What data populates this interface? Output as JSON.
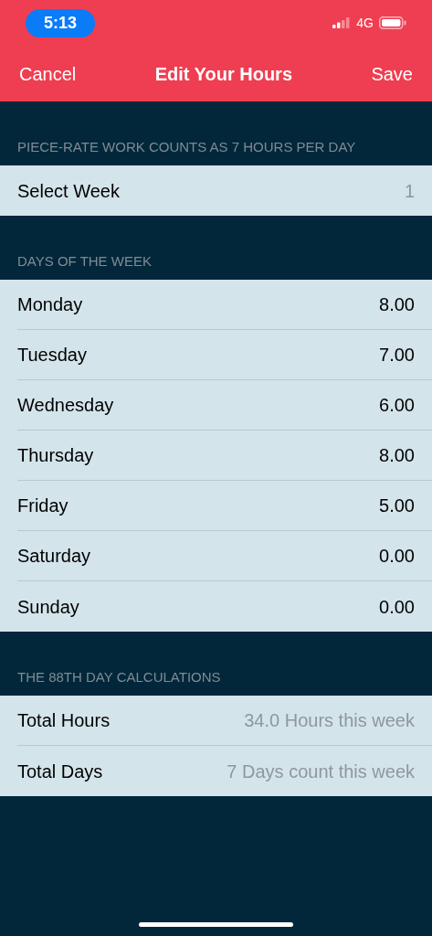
{
  "status_bar": {
    "time": "5:13",
    "network": "4G"
  },
  "nav_bar": {
    "cancel": "Cancel",
    "title": "Edit Your Hours",
    "save": "Save"
  },
  "sections": [
    {
      "header": "PIECE-RATE WORK COUNTS AS 7 HOURS PER DAY",
      "rows": [
        {
          "label": "Select Week",
          "value": "1",
          "kind": "detail"
        }
      ]
    },
    {
      "header": "DAYS OF THE WEEK",
      "rows": [
        {
          "label": "Monday",
          "value": "8.00",
          "kind": "entry"
        },
        {
          "label": "Tuesday",
          "value": "7.00",
          "kind": "entry"
        },
        {
          "label": "Wednesday",
          "value": "6.00",
          "kind": "entry"
        },
        {
          "label": "Thursday",
          "value": "8.00",
          "kind": "entry"
        },
        {
          "label": "Friday",
          "value": "5.00",
          "kind": "entry"
        },
        {
          "label": "Saturday",
          "value": "0.00",
          "kind": "entry"
        },
        {
          "label": "Sunday",
          "value": "0.00",
          "kind": "entry"
        }
      ]
    },
    {
      "header": "THE 88TH DAY CALCULATIONS",
      "rows": [
        {
          "label": "Total Hours",
          "value": "34.0 Hours this week",
          "kind": "detail"
        },
        {
          "label": "Total Days",
          "value": "7 Days count this week",
          "kind": "detail"
        }
      ]
    }
  ]
}
